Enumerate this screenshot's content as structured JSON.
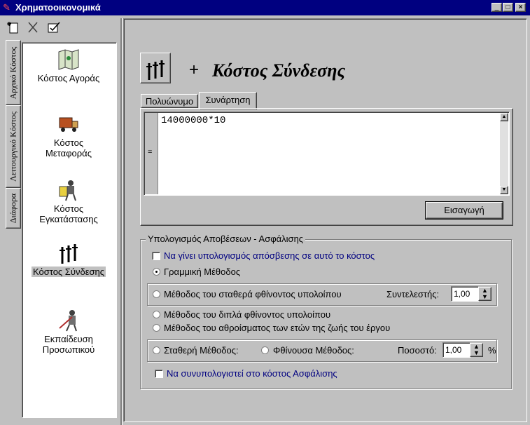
{
  "window": {
    "title": "Χρηματοοικονομικά",
    "minimize": "_",
    "maximize": "□",
    "close": "×"
  },
  "toolbar": {
    "new_icon": "new-doc-icon",
    "delete_icon": "delete-icon",
    "edit_icon": "edit-icon"
  },
  "vertical_tabs": [
    "Αρχικό Κόστος",
    "Λειτουργικό Κόστος",
    "Διάφορα"
  ],
  "nav_items": [
    {
      "label": "Κόστος Αγοράς",
      "icon": "map-icon"
    },
    {
      "label": "Κόστος Μεταφοράς",
      "icon": "truck-icon"
    },
    {
      "label": "Κόστος Εγκατάστασης",
      "icon": "worker-icon"
    },
    {
      "label": "Κόστος Σύνδεσης",
      "icon": "connection-icon",
      "selected": true
    },
    {
      "label": "Εκπαίδευση Προσωπικού",
      "icon": "teacher-icon"
    }
  ],
  "header": {
    "icon_text": "↑↑↑",
    "plus": "+",
    "title": "Κόστος Σύνδεσης"
  },
  "formula_tabs": [
    "Πολυώνυμο",
    "Συνάρτηση"
  ],
  "formula": {
    "equals": "=",
    "value": "14000000*10",
    "insert_button": "Εισαγωγή"
  },
  "depreciation": {
    "group_label": "Υπολογισμός Αποβέσεων - Ασφάλισης",
    "calc_checkbox": "Να γίνει υπολογισμός απόσβεσης σε αυτό το κόστος",
    "linear": "Γραμμική Μέθοδος",
    "declining": "Μέθοδος του σταθερά φθίνοντος υπολοίπου",
    "coef_label": "Συντελεστής:",
    "coef_value": "1,00",
    "double_declining": "Μέθοδος του διπλά φθίνοντος υπολοίπου",
    "sum_years": "Μέθοδος του αθροίσματος των ετών της ζωής του έργου",
    "fixed": "Σταθερή Μέθοδος:",
    "decreasing": "Φθίνουσα Μέθοδος:",
    "percent_label": "Ποσοστό:",
    "percent_value": "1,00",
    "percent_sign": "%",
    "insurance_checkbox": "Να συνυπολογιστεί στο κόστος Ασφάλισης"
  },
  "colors": {
    "title_bar": "#000080",
    "link_text": "#000080",
    "face": "#c0c0c0"
  }
}
